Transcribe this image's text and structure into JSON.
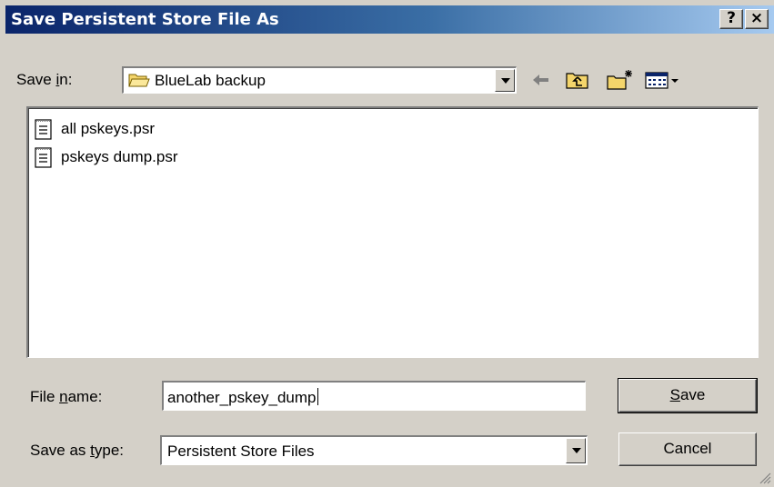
{
  "window": {
    "title": "Save Persistent Store File As",
    "help_label": "?",
    "close_label": "×"
  },
  "save_in": {
    "label_pre": "Save ",
    "label_key": "i",
    "label_post": "n:",
    "value": "BlueLab backup",
    "icon": "folder-icon"
  },
  "toolbar": {
    "back_icon": "back-arrow-icon",
    "up_icon": "up-one-level-icon",
    "new_folder_icon": "new-folder-icon",
    "views_icon": "views-menu-icon"
  },
  "files": [
    {
      "name": "all pskeys.psr",
      "icon": "document-icon"
    },
    {
      "name": "pskeys dump.psr",
      "icon": "document-icon"
    }
  ],
  "file_name": {
    "label_pre": "File ",
    "label_key": "n",
    "label_post": "ame:",
    "value": "another_pskey_dump"
  },
  "save_as_type": {
    "label_pre": "Save as ",
    "label_key": "t",
    "label_post": "ype:",
    "value": "Persistent Store Files"
  },
  "buttons": {
    "save_key": "S",
    "save_rest": "ave",
    "cancel": "Cancel"
  },
  "colors": {
    "face": "#d4d0c8",
    "title_start": "#0a246a",
    "title_end": "#a6caf0"
  }
}
